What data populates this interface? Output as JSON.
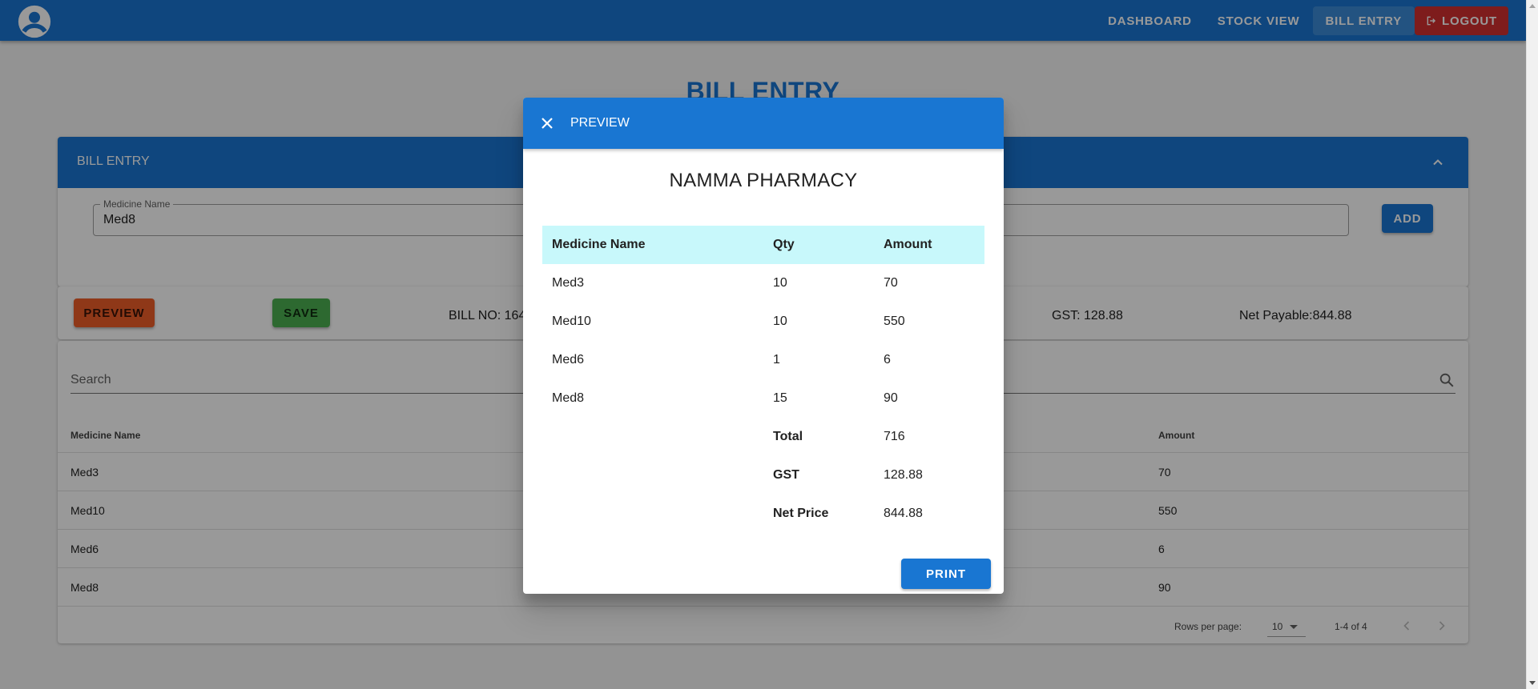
{
  "nav": {
    "dashboard": "DASHBOARD",
    "stock_view": "STOCK VIEW",
    "bill_entry": "BILL ENTRY",
    "logout": "LOGOUT"
  },
  "page": {
    "title": "BILL ENTRY"
  },
  "entry": {
    "header": "BILL ENTRY",
    "medicine_label": "Medicine Name",
    "medicine_value": "Med8",
    "add_label": "ADD"
  },
  "summary": {
    "preview_label": "PREVIEW",
    "save_label": "SAVE",
    "bill_no": "BILL NO: 164",
    "gst": "GST: 128.88",
    "net_payable": "Net Payable:844.88"
  },
  "table": {
    "search_placeholder": "Search",
    "col_name": "Medicine Name",
    "col_amount": "Amount",
    "rows": [
      {
        "name": "Med3",
        "amount": "70"
      },
      {
        "name": "Med10",
        "amount": "550"
      },
      {
        "name": "Med6",
        "amount": "6"
      },
      {
        "name": "Med8",
        "amount": "90"
      }
    ],
    "rows_per_page_label": "Rows per page:",
    "rows_per_page_value": "10",
    "page_count": "1-4 of 4"
  },
  "dialog": {
    "title": "PREVIEW",
    "store_name": "NAMMA PHARMACY",
    "headers": {
      "name": "Medicine Name",
      "qty": "Qty",
      "amount": "Amount"
    },
    "items": [
      {
        "name": "Med3",
        "qty": "10",
        "amount": "70"
      },
      {
        "name": "Med10",
        "qty": "10",
        "amount": "550"
      },
      {
        "name": "Med6",
        "qty": "1",
        "amount": "6"
      },
      {
        "name": "Med8",
        "qty": "15",
        "amount": "90"
      }
    ],
    "totals": [
      {
        "label": "Total",
        "value": "716"
      },
      {
        "label": "GST",
        "value": "128.88"
      },
      {
        "label": "Net Price",
        "value": "844.88"
      }
    ],
    "print_label": "PRINT"
  },
  "colors": {
    "primary": "#1976d2",
    "preview_button": "#ef5e28",
    "save_button": "#4caf50",
    "logout_button": "#d32f2f",
    "dialog_table_header": "#c8f8fb"
  },
  "icons": {
    "avatar": "account-circle-icon",
    "logout": "logout-icon",
    "collapse": "chevron-up-icon",
    "search": "search-icon",
    "close": "close-icon",
    "prev_page": "chevron-left-icon",
    "next_page": "chevron-right-icon"
  }
}
